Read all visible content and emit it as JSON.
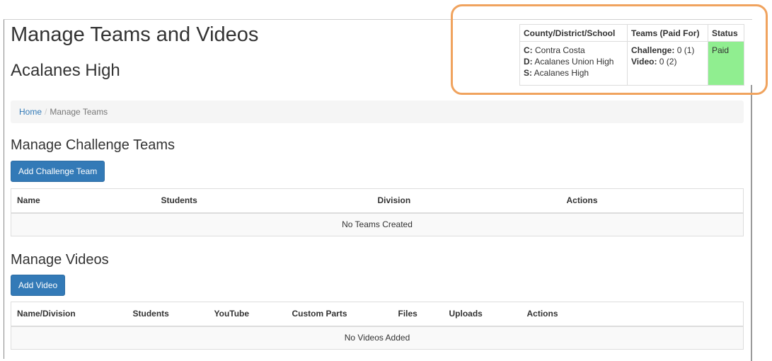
{
  "header": {
    "title": "Manage Teams and Videos",
    "school": "Acalanes High"
  },
  "status_table": {
    "headers": [
      "County/District/School",
      "Teams (Paid For)",
      "Status"
    ],
    "county_label": "C:",
    "county_value": "Contra Costa",
    "district_label": "D:",
    "district_value": "Acalanes Union High",
    "school_label": "S:",
    "school_value": "Acalanes High",
    "challenge_label": "Challenge:",
    "challenge_value": "0 (1)",
    "video_label": "Video:",
    "video_value": "0 (2)",
    "status": "Paid",
    "status_color": "#90ee90",
    "highlight_color": "#f0a35e"
  },
  "breadcrumb": {
    "home": "Home",
    "separator": "/",
    "current": "Manage Teams"
  },
  "challenge_section": {
    "title": "Manage Challenge Teams",
    "add_button": "Add Challenge Team",
    "columns": [
      "Name",
      "Students",
      "Division",
      "Actions"
    ],
    "empty_message": "No Teams Created"
  },
  "video_section": {
    "title": "Manage Videos",
    "add_button": "Add Video",
    "columns": [
      "Name/Division",
      "Students",
      "YouTube",
      "Custom Parts",
      "Files",
      "Uploads",
      "Actions"
    ],
    "empty_message": "No Videos Added"
  },
  "colors": {
    "primary": "#337ab7",
    "text": "#333333",
    "link": "#337ab7"
  }
}
